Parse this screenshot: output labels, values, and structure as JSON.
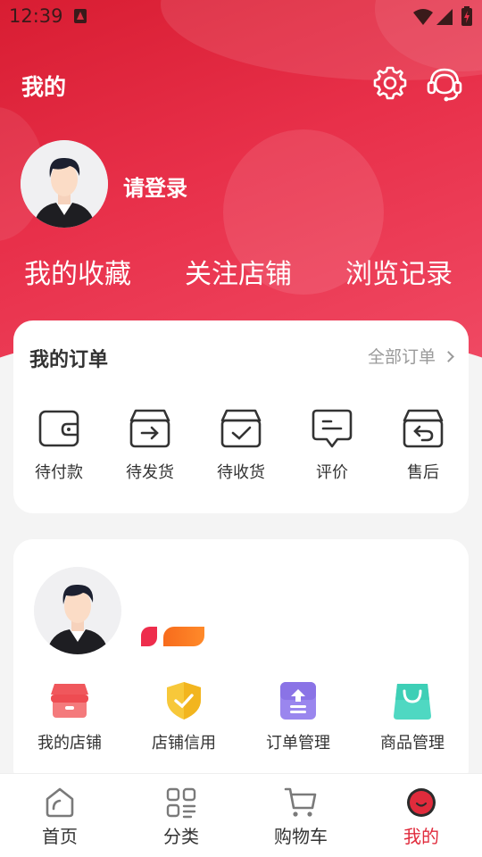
{
  "status_bar": {
    "time": "12:39"
  },
  "header": {
    "title": "我的",
    "settings_icon": "gear-icon",
    "service_icon": "customer-service-headset-icon"
  },
  "profile": {
    "login_text": "请登录"
  },
  "quick_links": [
    {
      "label": "我的收藏"
    },
    {
      "label": "关注店铺"
    },
    {
      "label": "浏览记录"
    }
  ],
  "orders": {
    "title": "我的订单",
    "all_label": "全部订单",
    "items": [
      {
        "label": "待付款",
        "icon": "wallet-icon"
      },
      {
        "label": "待发货",
        "icon": "ship-box-icon"
      },
      {
        "label": "待收货",
        "icon": "receive-box-icon"
      },
      {
        "label": "评价",
        "icon": "comment-icon"
      },
      {
        "label": "售后",
        "icon": "return-box-icon"
      }
    ]
  },
  "shop_tools": {
    "items": [
      {
        "label": "我的店铺",
        "icon": "store-icon"
      },
      {
        "label": "店铺信用",
        "icon": "shield-check-icon"
      },
      {
        "label": "订单管理",
        "icon": "order-upload-icon"
      },
      {
        "label": "商品管理",
        "icon": "shopping-bag-icon"
      }
    ]
  },
  "tabbar": {
    "tabs": [
      {
        "label": "首页",
        "icon": "home-icon"
      },
      {
        "label": "分类",
        "icon": "category-icon"
      },
      {
        "label": "购物车",
        "icon": "cart-icon"
      },
      {
        "label": "我的",
        "icon": "profile-icon",
        "active": true
      }
    ]
  },
  "colors": {
    "accent": "#e02b3c",
    "header_start": "#d81d32",
    "header_end": "#f04a64"
  }
}
